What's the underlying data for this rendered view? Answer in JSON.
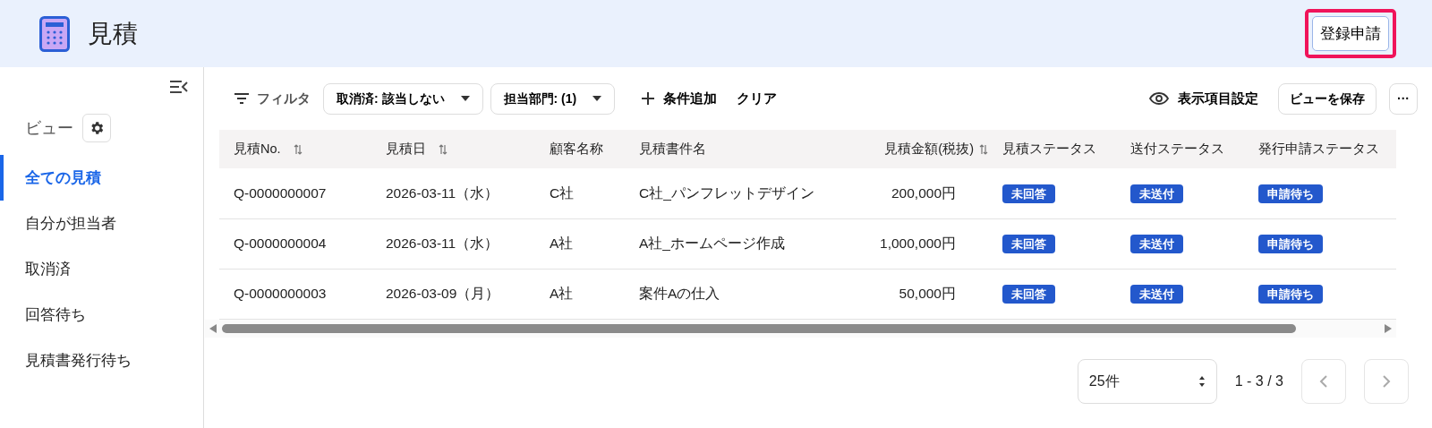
{
  "header": {
    "title": "見積",
    "register_button": {
      "label": "登録申請",
      "highlighted": true
    }
  },
  "sidebar": {
    "view_label": "ビュー",
    "items": [
      {
        "label": "全ての見積",
        "selected": true
      },
      {
        "label": "自分が担当者",
        "selected": false
      },
      {
        "label": "取消済",
        "selected": false
      },
      {
        "label": "回答待ち",
        "selected": false
      },
      {
        "label": "見積書発行待ち",
        "selected": false
      }
    ]
  },
  "toolbar": {
    "filter_label": "フィルタ",
    "filters": [
      "取消済: 該当しない",
      "担当部門: (1)"
    ],
    "add_condition": "条件追加",
    "clear": "クリア",
    "display_settings": "表示項目設定",
    "save_view": "ビューを保存",
    "more": "···"
  },
  "table": {
    "columns": [
      {
        "label": "見積No.",
        "sortable": true,
        "kind": "text"
      },
      {
        "label": "見積日",
        "sortable": true,
        "kind": "text"
      },
      {
        "label": "顧客名称",
        "sortable": false,
        "kind": "text"
      },
      {
        "label": "見積書件名",
        "sortable": false,
        "kind": "text"
      },
      {
        "label": "見積金額(税抜)",
        "sortable": true,
        "kind": "amount"
      },
      {
        "label": "見積ステータス",
        "sortable": false,
        "kind": "status"
      },
      {
        "label": "送付ステータス",
        "sortable": false,
        "kind": "status"
      },
      {
        "label": "発行申請ステータス",
        "sortable": false,
        "kind": "status"
      }
    ],
    "rows": [
      {
        "cells": [
          "Q-0000000007",
          "2026-03-11（水）",
          "C社",
          "C社_パンフレットデザイン",
          "200,000円"
        ],
        "badges": [
          "未回答",
          "未送付",
          "申請待ち"
        ]
      },
      {
        "cells": [
          "Q-0000000004",
          "2026-03-11（水）",
          "A社",
          "A社_ホームページ作成",
          "1,000,000円"
        ],
        "badges": [
          "未回答",
          "未送付",
          "申請待ち"
        ]
      },
      {
        "cells": [
          "Q-0000000003",
          "2026-03-09（月）",
          "A社",
          "案件Aの仕入",
          "50,000円"
        ],
        "badges": [
          "未回答",
          "未送付",
          "申請待ち"
        ]
      }
    ]
  },
  "pagination": {
    "page_size": "25件",
    "range": "1 - 3 / 3",
    "prev_disabled": true,
    "next_disabled": true
  }
}
